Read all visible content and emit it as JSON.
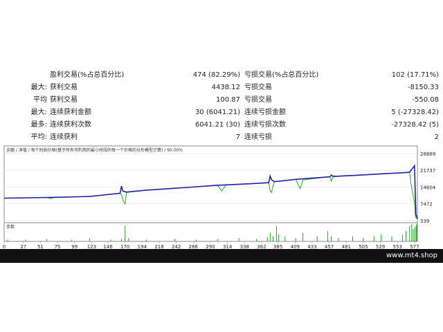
{
  "stats": {
    "rows": [
      {
        "label": "",
        "name": "盈利交易(%占总百分比)",
        "value": "474 (82.29%)",
        "name2": "亏损交易(%占总百分比)",
        "value2": "102 (17.71%)"
      },
      {
        "label": "最大:",
        "name": "获利交易",
        "value": "4438.12",
        "name2": "亏损交易",
        "value2": "-8150.33"
      },
      {
        "label": "平均",
        "name": "获利交易",
        "value": "100.87",
        "name2": "亏损交易",
        "value2": "-550.08"
      },
      {
        "label": "最大:",
        "name": "连续获利金额",
        "value": "30 (6041.21)",
        "name2": "连续亏损金额",
        "value2": "5 (-27328.42)"
      },
      {
        "label": "最多:",
        "name": "连续获利次数",
        "value": "6041.21 (30)",
        "name2": "连续亏损次数",
        "value2": "-27328.42 (5)"
      },
      {
        "label": "平均:",
        "name": "连续获利",
        "value": "7",
        "name2": "连续亏损",
        "value2": "2"
      }
    ]
  },
  "chart_data": {
    "type": "line",
    "title": "余额 / 净值 / 每个时刻价格(基于所有可利用的最小时段的每一个价格的分形模型计算) / 90.00%",
    "legend": [
      "余额",
      "净值"
    ],
    "volume_label": "手数",
    "colors": {
      "balance": "#1f1fa8",
      "equity": "#22aa22",
      "volume": "#22aa22",
      "frame": "#8a8a8a"
    },
    "y_ticks": [
      28869,
      21737,
      14604,
      7472,
      339
    ],
    "ylim": [
      339,
      28869
    ],
    "x_ticks": [
      0,
      27,
      51,
      75,
      99,
      123,
      146,
      170,
      194,
      218,
      242,
      266,
      290,
      314,
      338,
      362,
      385,
      409,
      433,
      457,
      481,
      505,
      529,
      553,
      577
    ],
    "xlim": [
      0,
      581
    ],
    "balance": {
      "x": [
        0,
        60,
        120,
        163,
        165,
        167,
        172,
        200,
        250,
        300,
        312,
        350,
        372,
        374,
        376,
        380,
        410,
        450,
        458,
        460,
        462,
        466,
        500,
        540,
        560,
        570,
        577,
        578,
        579,
        581
      ],
      "y": [
        9900,
        10200,
        10600,
        12000,
        15000,
        12900,
        12500,
        13300,
        14300,
        15400,
        15550,
        16100,
        16500,
        19300,
        17700,
        16900,
        17900,
        18800,
        19000,
        19700,
        19300,
        19200,
        19700,
        20400,
        20700,
        20900,
        23700,
        12000,
        3000,
        1200
      ]
    },
    "equity": {
      "x": [
        0,
        60,
        65,
        70,
        120,
        163,
        165,
        167,
        170,
        172,
        200,
        300,
        306,
        312,
        350,
        372,
        374,
        376,
        378,
        380,
        410,
        416,
        420,
        450,
        458,
        460,
        462,
        466,
        500,
        540,
        560,
        570,
        572,
        577,
        578,
        579,
        581
      ],
      "y": [
        9900,
        10200,
        9700,
        10100,
        10600,
        12000,
        11500,
        9000,
        7400,
        12300,
        13300,
        15400,
        13000,
        15500,
        16100,
        16500,
        13000,
        12300,
        15200,
        16900,
        17900,
        13900,
        17600,
        18800,
        19000,
        17100,
        18800,
        19200,
        19700,
        20400,
        20700,
        20900,
        15900,
        8000,
        3000,
        1500,
        1100
      ]
    },
    "volume": {
      "x": [
        5,
        30,
        60,
        95,
        120,
        150,
        165,
        170,
        175,
        200,
        240,
        270,
        300,
        330,
        355,
        370,
        374,
        378,
        383,
        386,
        395,
        410,
        420,
        440,
        455,
        460,
        470,
        490,
        505,
        520,
        530,
        545,
        560,
        565,
        570,
        573,
        575,
        577,
        579,
        580
      ],
      "v": [
        0.1,
        0.1,
        0.15,
        0.1,
        0.2,
        0.1,
        0.15,
        0.9,
        0.2,
        0.1,
        0.15,
        0.1,
        0.15,
        0.2,
        0.15,
        0.25,
        0.5,
        0.3,
        0.9,
        0.4,
        0.3,
        0.2,
        0.5,
        0.3,
        0.6,
        0.3,
        0.2,
        0.3,
        0.2,
        0.3,
        0.4,
        0.3,
        0.4,
        0.6,
        0.9,
        1.0,
        0.7,
        0.8,
        0.9,
        1.0
      ]
    }
  },
  "footer": {
    "site": "www.mt4.shop"
  }
}
